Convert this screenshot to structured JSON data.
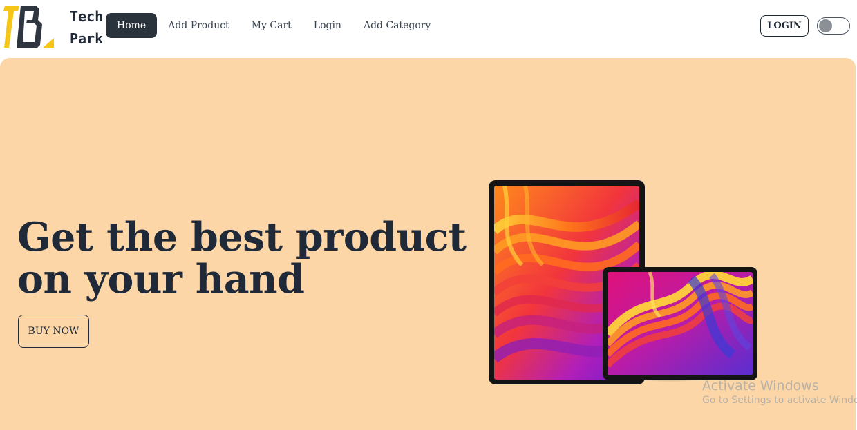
{
  "brand": {
    "line1": "Tech",
    "line2": "Park",
    "logo_colors": {
      "yellow": "#f5c518",
      "dark": "#2f3640"
    }
  },
  "nav": {
    "items": [
      {
        "label": "Home",
        "active": true
      },
      {
        "label": "Add Product",
        "active": false
      },
      {
        "label": "My Cart",
        "active": false
      },
      {
        "label": "Login",
        "active": false
      },
      {
        "label": "Add Category",
        "active": false
      }
    ],
    "login_button": "LOGIN",
    "theme_toggle": {
      "on": false
    }
  },
  "hero": {
    "title_line1": "Get the best product",
    "title_line2": "on your hand",
    "cta": "BUY NOW",
    "background": "#fdd6a8",
    "image": "tablets-illustration"
  },
  "watermark": {
    "title": "Activate Windows",
    "subtitle": "Go to Settings to activate Windows."
  }
}
